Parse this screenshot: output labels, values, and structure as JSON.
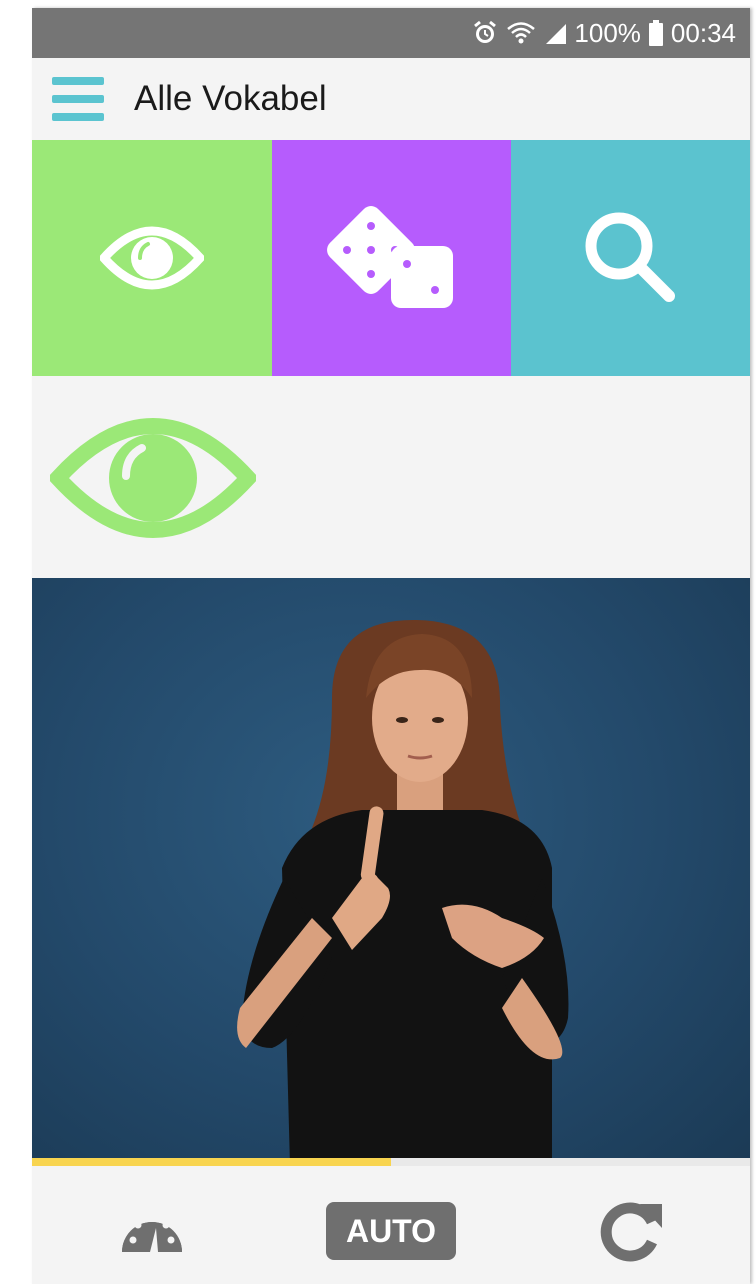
{
  "status_bar": {
    "battery_percent": "100%",
    "time": "00:34",
    "icons": [
      "alarm-icon",
      "wifi-icon",
      "signal-icon",
      "battery-icon"
    ]
  },
  "app_bar": {
    "title": "Alle Vokabel",
    "menu_icon": "hamburger-menu-icon"
  },
  "mode_tiles": [
    {
      "icon": "eye-icon",
      "color": "#9be877"
    },
    {
      "icon": "dice-icon",
      "color": "#b65cfd"
    },
    {
      "icon": "search-icon",
      "color": "#5bc3cf"
    }
  ],
  "current_mode": {
    "icon": "eye-icon",
    "color": "#9be877"
  },
  "video": {
    "progress_fraction": 0.5
  },
  "controls": {
    "speed_icon": "speedometer-icon",
    "auto_label": "AUTO",
    "repeat_icon": "repeat-icon"
  },
  "colors": {
    "accent": "#5bc4d0",
    "progress": "#f8d44f",
    "status_bar": "#757575",
    "button_gray": "#6f6f6f"
  }
}
